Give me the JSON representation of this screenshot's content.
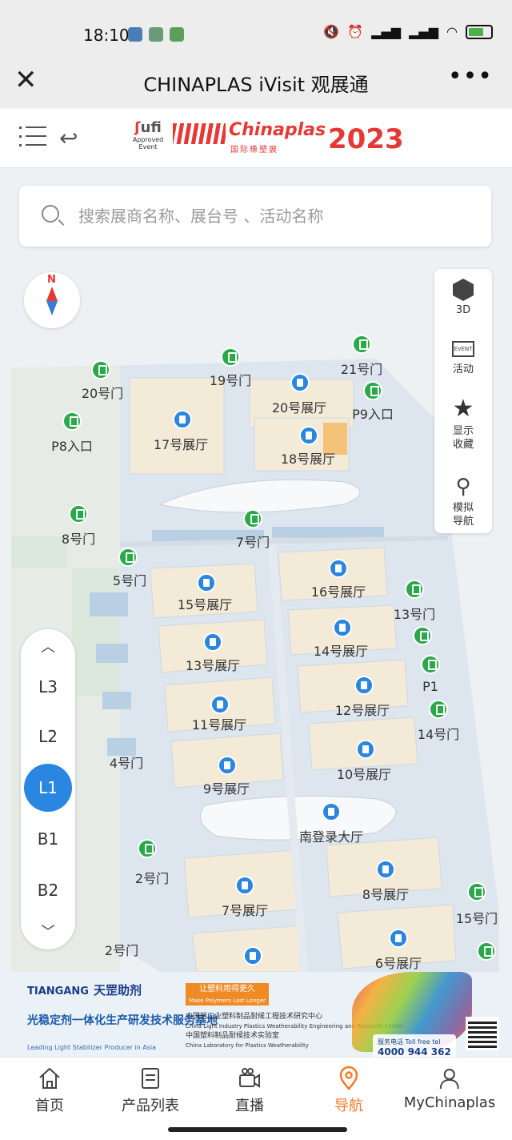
{
  "status_bar": {
    "time": "18:10"
  },
  "window": {
    "title": "CHINAPLAS iVisit 观展通"
  },
  "header": {
    "ufi_logo": {
      "name": "ufi",
      "line1": "Approved",
      "line2": "Event"
    },
    "brand": {
      "name": "Chinaplas",
      "subtitle": "国际橡塑展",
      "year": "2023"
    }
  },
  "search": {
    "placeholder": "搜索展商名称、展台号 、活动名称"
  },
  "compass": {
    "label": "N"
  },
  "tools": [
    {
      "label": "3D",
      "icon": "cube-icon"
    },
    {
      "label": "活动",
      "icon": "event-icon"
    },
    {
      "label": "显示收藏",
      "line1": "显示",
      "line2": "收藏",
      "icon": "star-icon"
    },
    {
      "label": "模拟导航",
      "line1": "模拟",
      "line2": "导航",
      "icon": "route-icon"
    }
  ],
  "floors": {
    "options": [
      "L3",
      "L2",
      "L1",
      "B1",
      "B2"
    ],
    "active": "L1"
  },
  "halls": [
    "17号展厅",
    "20号展厅",
    "18号展厅",
    "15号展厅",
    "16号展厅",
    "13号展厅",
    "14号展厅",
    "11号展厅",
    "12号展厅",
    "9号展厅",
    "10号展厅",
    "南登录大厅",
    "7号展厅",
    "8号展厅",
    "6号展厅"
  ],
  "gates": [
    "20号门",
    "19号门",
    "21号门",
    "P9入口",
    "P8入口",
    "8号门",
    "7号门",
    "5号门",
    "13号门",
    "P1",
    "14号门",
    "4号门",
    "2号门",
    "15号门"
  ],
  "gate_labels_no_pin": [
    "2号门"
  ],
  "ad": {
    "brand_en": "TIANGANG",
    "brand_cn": "天罡助剂",
    "tagline_cn": "光稳定剂一体化生产研发技术服务基地",
    "tagline_en": "Leading Light Stabilizer Producer in Asia",
    "slogan_cn": "让塑料用得更久",
    "slogan_en": "Make Polymers Last Longer",
    "line1_cn": "中国轻工业塑料制品耐候工程技术研究中心",
    "line1_en": "China Light Industry Plastics Weatherability Engineering and Research Center",
    "line2_cn": "中国塑料制品耐候技术实验室",
    "line2_en": "China Laboratory for Plastics Weatherability",
    "phone": "4000 944 362",
    "hotline": "服务电话 Toll free tel"
  },
  "bottom_nav": [
    {
      "label": "首页",
      "icon": "home-icon"
    },
    {
      "label": "产品列表",
      "icon": "list-icon"
    },
    {
      "label": "直播",
      "icon": "live-camera-icon"
    },
    {
      "label": "导航",
      "icon": "location-pin-icon",
      "active": true
    },
    {
      "label": "MyChinaplas",
      "icon": "user-icon"
    }
  ],
  "colors": {
    "accent": "#2a86e0",
    "nav_active": "#f07b2c",
    "brand_red": "#e53935",
    "gate_green": "#2aa84a"
  }
}
